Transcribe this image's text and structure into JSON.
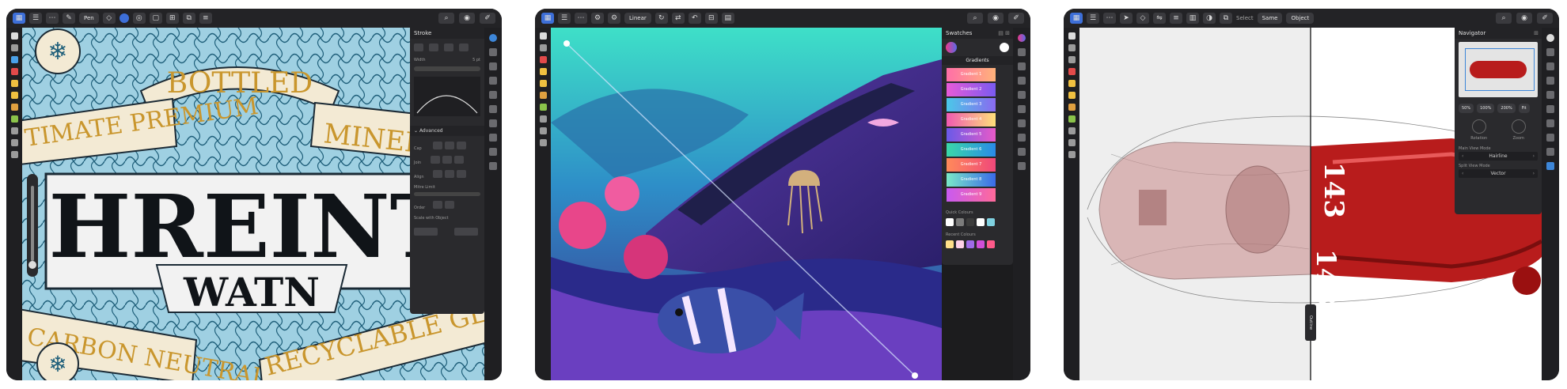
{
  "screen1": {
    "toolbar": {
      "tool_label": "Pen"
    },
    "artwork": {
      "banner_top": "BOTTLED",
      "left_arc": "TIMATE PREMIUM",
      "right_arc": "MINERA",
      "headline": "HREINT",
      "subline": "WATN",
      "bottom_left": "CARBON NEUTRAL",
      "bottom_right": "RECYCLABLE GLASS"
    },
    "stroke_panel": {
      "title": "Stroke",
      "width_label": "Width",
      "width_value": "5 pt",
      "advanced_label": "Advanced",
      "cap_label": "Cap",
      "join_label": "Join",
      "align_label": "Align",
      "mitre_label": "Mitre Limit",
      "order_label": "Order",
      "scale_label": "Scale with Object"
    }
  },
  "screen2": {
    "toolbar": {
      "mode_label": "Linear"
    },
    "swatches_panel": {
      "title": "Swatches",
      "category": "Gradients",
      "items": [
        "Gradient 1",
        "Gradient 2",
        "Gradient 3",
        "Gradient 4",
        "Gradient 5",
        "Gradient 6",
        "Gradient 7",
        "Gradient 8",
        "Gradient 9"
      ],
      "quick_colours_label": "Quick Colours",
      "recent_colours_label": "Recent Colours",
      "quick_colours": [
        "#ffffff",
        "#7c7c7c",
        "#3c3c3c",
        "#ffffff",
        "#7fd1e0"
      ],
      "recent_colours": [
        "#ffe08a",
        "#ffd1e8",
        "#a06be8",
        "#d14fd8",
        "#ff5a8a"
      ]
    }
  },
  "screen3": {
    "toolbar": {
      "select_label": "Select",
      "same_label": "Same",
      "object_label": "Object"
    },
    "navigator_panel": {
      "title": "Navigator",
      "zoom_levels": [
        "50%",
        "100%",
        "200%",
        "Fit"
      ],
      "rotation_label": "Rotation",
      "zoom_label": "Zoom",
      "main_view_mode_label": "Main View Mode",
      "main_view_mode_value": "Hairline",
      "split_view_mode_label": "Split View Mode",
      "split_view_mode_value": "Vector"
    },
    "split_handle_label": "Outline",
    "car_number": "143"
  }
}
